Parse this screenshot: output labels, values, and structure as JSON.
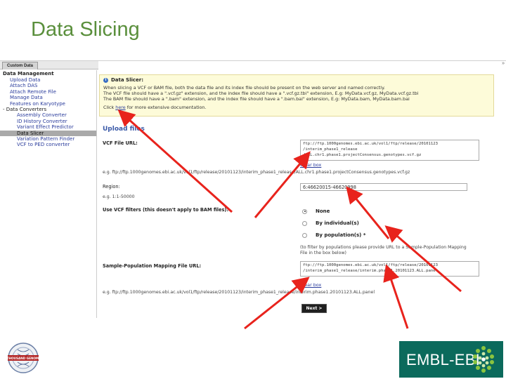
{
  "slide": {
    "title": "Data Slicing"
  },
  "tab": {
    "label": "Custom Data"
  },
  "sidebar": {
    "heading": "Data Management",
    "items": [
      {
        "label": "Upload Data",
        "level": 1
      },
      {
        "label": "Attach DAS",
        "level": 1
      },
      {
        "label": "Attach Remote File",
        "level": 1
      },
      {
        "label": "Manage Data",
        "level": 1
      },
      {
        "label": "Features on Karyotype",
        "level": 1
      },
      {
        "label": "- Data Converters",
        "level": 0
      },
      {
        "label": "Assembly Converter",
        "level": 2
      },
      {
        "label": "ID History Converter",
        "level": 2
      },
      {
        "label": "Variant Effect Predictor",
        "level": 2
      },
      {
        "label": "Data Slicer",
        "level": 2,
        "selected": true
      },
      {
        "label": "Variation Pattern Finder",
        "level": 2
      },
      {
        "label": "VCF to PED converter",
        "level": 2
      }
    ]
  },
  "info": {
    "title": "Data Slicer:",
    "line1": "When slicing a VCF or BAM file, both the data file and its index file should be present on the web server and named correctly.",
    "line2": "The VCF file should have a \".vcf.gz\" extension, and the index file should have a \".vcf.gz.tbi\" extension, E.g: MyData.vcf.gz, MyData.vcf.gz.tbi",
    "line3": "The BAM file should have a \".bam\" extension, and the index file should have a \".bam.bai\" extension, E.g: MyData.bam, MyData.bam.bai",
    "line4_pre": "Click ",
    "line4_link": "here",
    "line4_post": " for more extensive documentation."
  },
  "form": {
    "upload_heading": "Upload files",
    "vcf_label": "VCF File URL:",
    "vcf_value": "ftp://ftp.1000genomes.ebi.ac.uk/vol1/ftp/release/20101123\n/interim_phase1_release\n/ALL.chr1.phase1.projectConsensus.genotypes.vcf.gz",
    "vcf_clear": "Clear box",
    "vcf_example": "e.g. ftp://ftp.1000genomes.ebi.ac.uk/vol1/ftp/release/20101123/interim_phase1_release/ALL.chr1.phase1.projectConsensus.genotypes.vcf.gz",
    "region_label": "Region:",
    "region_value": "6:46620015-46620998",
    "region_example": "e.g. 1:1-50000",
    "filters_label": "Use VCF filters (this doesn't apply to BAM files):",
    "radio_none": "None",
    "radio_individual": "By individual(s)",
    "radio_population": "By population(s) *",
    "population_note1": "(to filter by populations please provide URL to a Sample-Population Mapping",
    "population_note2": "File in the box below)",
    "mapping_label": "Sample-Population Mapping File URL:",
    "mapping_value": "ftp://ftp.1000genomes.ebi.ac.uk/vol1/ftp/release/20101123\n/interim_phase1_release/interim.phase1.20101123.ALL.panel",
    "mapping_clear": "Clear box",
    "mapping_example": "e.g. ftp://ftp.1000genomes.ebi.ac.uk/vol1/ftp/release/20101123/interim_phase1_release/interim.phase1.20101123.ALL.panel",
    "next_label": "Next >"
  },
  "logos": {
    "seal_text": "A THOUSAND GENOMES",
    "ebi_text": "EMBL-EBI"
  },
  "colors": {
    "title_green": "#5a8f3c",
    "annotation_red": "#e8231c",
    "ebi_teal": "#0b6a5c",
    "link_blue": "#2a3c9c"
  }
}
